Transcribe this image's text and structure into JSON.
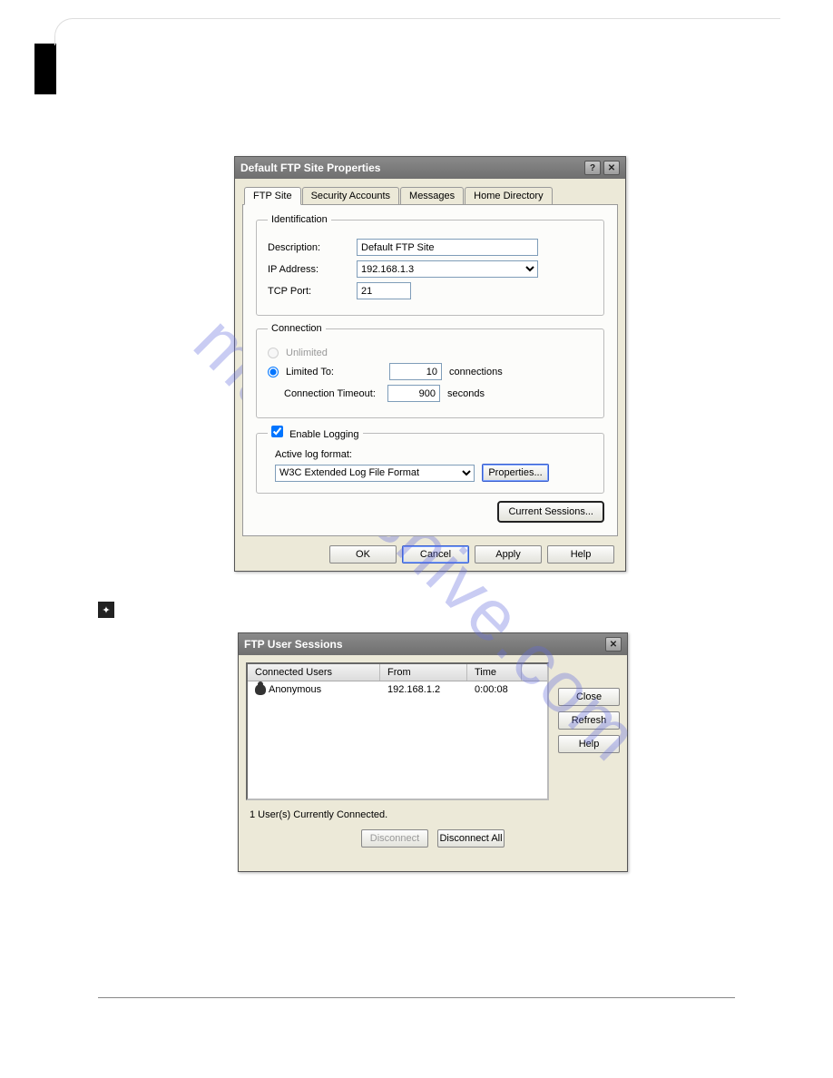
{
  "dialog1": {
    "title": "Default FTP Site Properties",
    "tabs": [
      "FTP Site",
      "Security Accounts",
      "Messages",
      "Home Directory"
    ],
    "active_tab": 0,
    "identification": {
      "legend": "Identification",
      "description_label": "Description:",
      "description_value": "Default FTP Site",
      "ip_label": "IP Address:",
      "ip_value": "192.168.1.3",
      "port_label": "TCP Port:",
      "port_value": "21"
    },
    "connection": {
      "legend": "Connection",
      "unlimited_label": "Unlimited",
      "limited_label": "Limited To:",
      "limited_value": "10",
      "limited_unit": "connections",
      "timeout_label": "Connection Timeout:",
      "timeout_value": "900",
      "timeout_unit": "seconds"
    },
    "logging": {
      "enable_label": "Enable Logging",
      "active_format_label": "Active log format:",
      "format_value": "W3C Extended Log File Format",
      "properties_btn": "Properties..."
    },
    "current_sessions_btn": "Current Sessions...",
    "buttons": {
      "ok": "OK",
      "cancel": "Cancel",
      "apply": "Apply",
      "help": "Help"
    }
  },
  "dialog2": {
    "title": "FTP User Sessions",
    "columns": [
      "Connected Users",
      "From",
      "Time"
    ],
    "rows": [
      {
        "user": "Anonymous",
        "from": "192.168.1.2",
        "time": "0:00:08"
      }
    ],
    "side_buttons": {
      "close": "Close",
      "refresh": "Refresh",
      "help": "Help"
    },
    "status": "1 User(s) Currently Connected.",
    "bottom_buttons": {
      "disconnect": "Disconnect",
      "disconnect_all": "Disconnect All"
    }
  },
  "watermark": "manualshive.com"
}
